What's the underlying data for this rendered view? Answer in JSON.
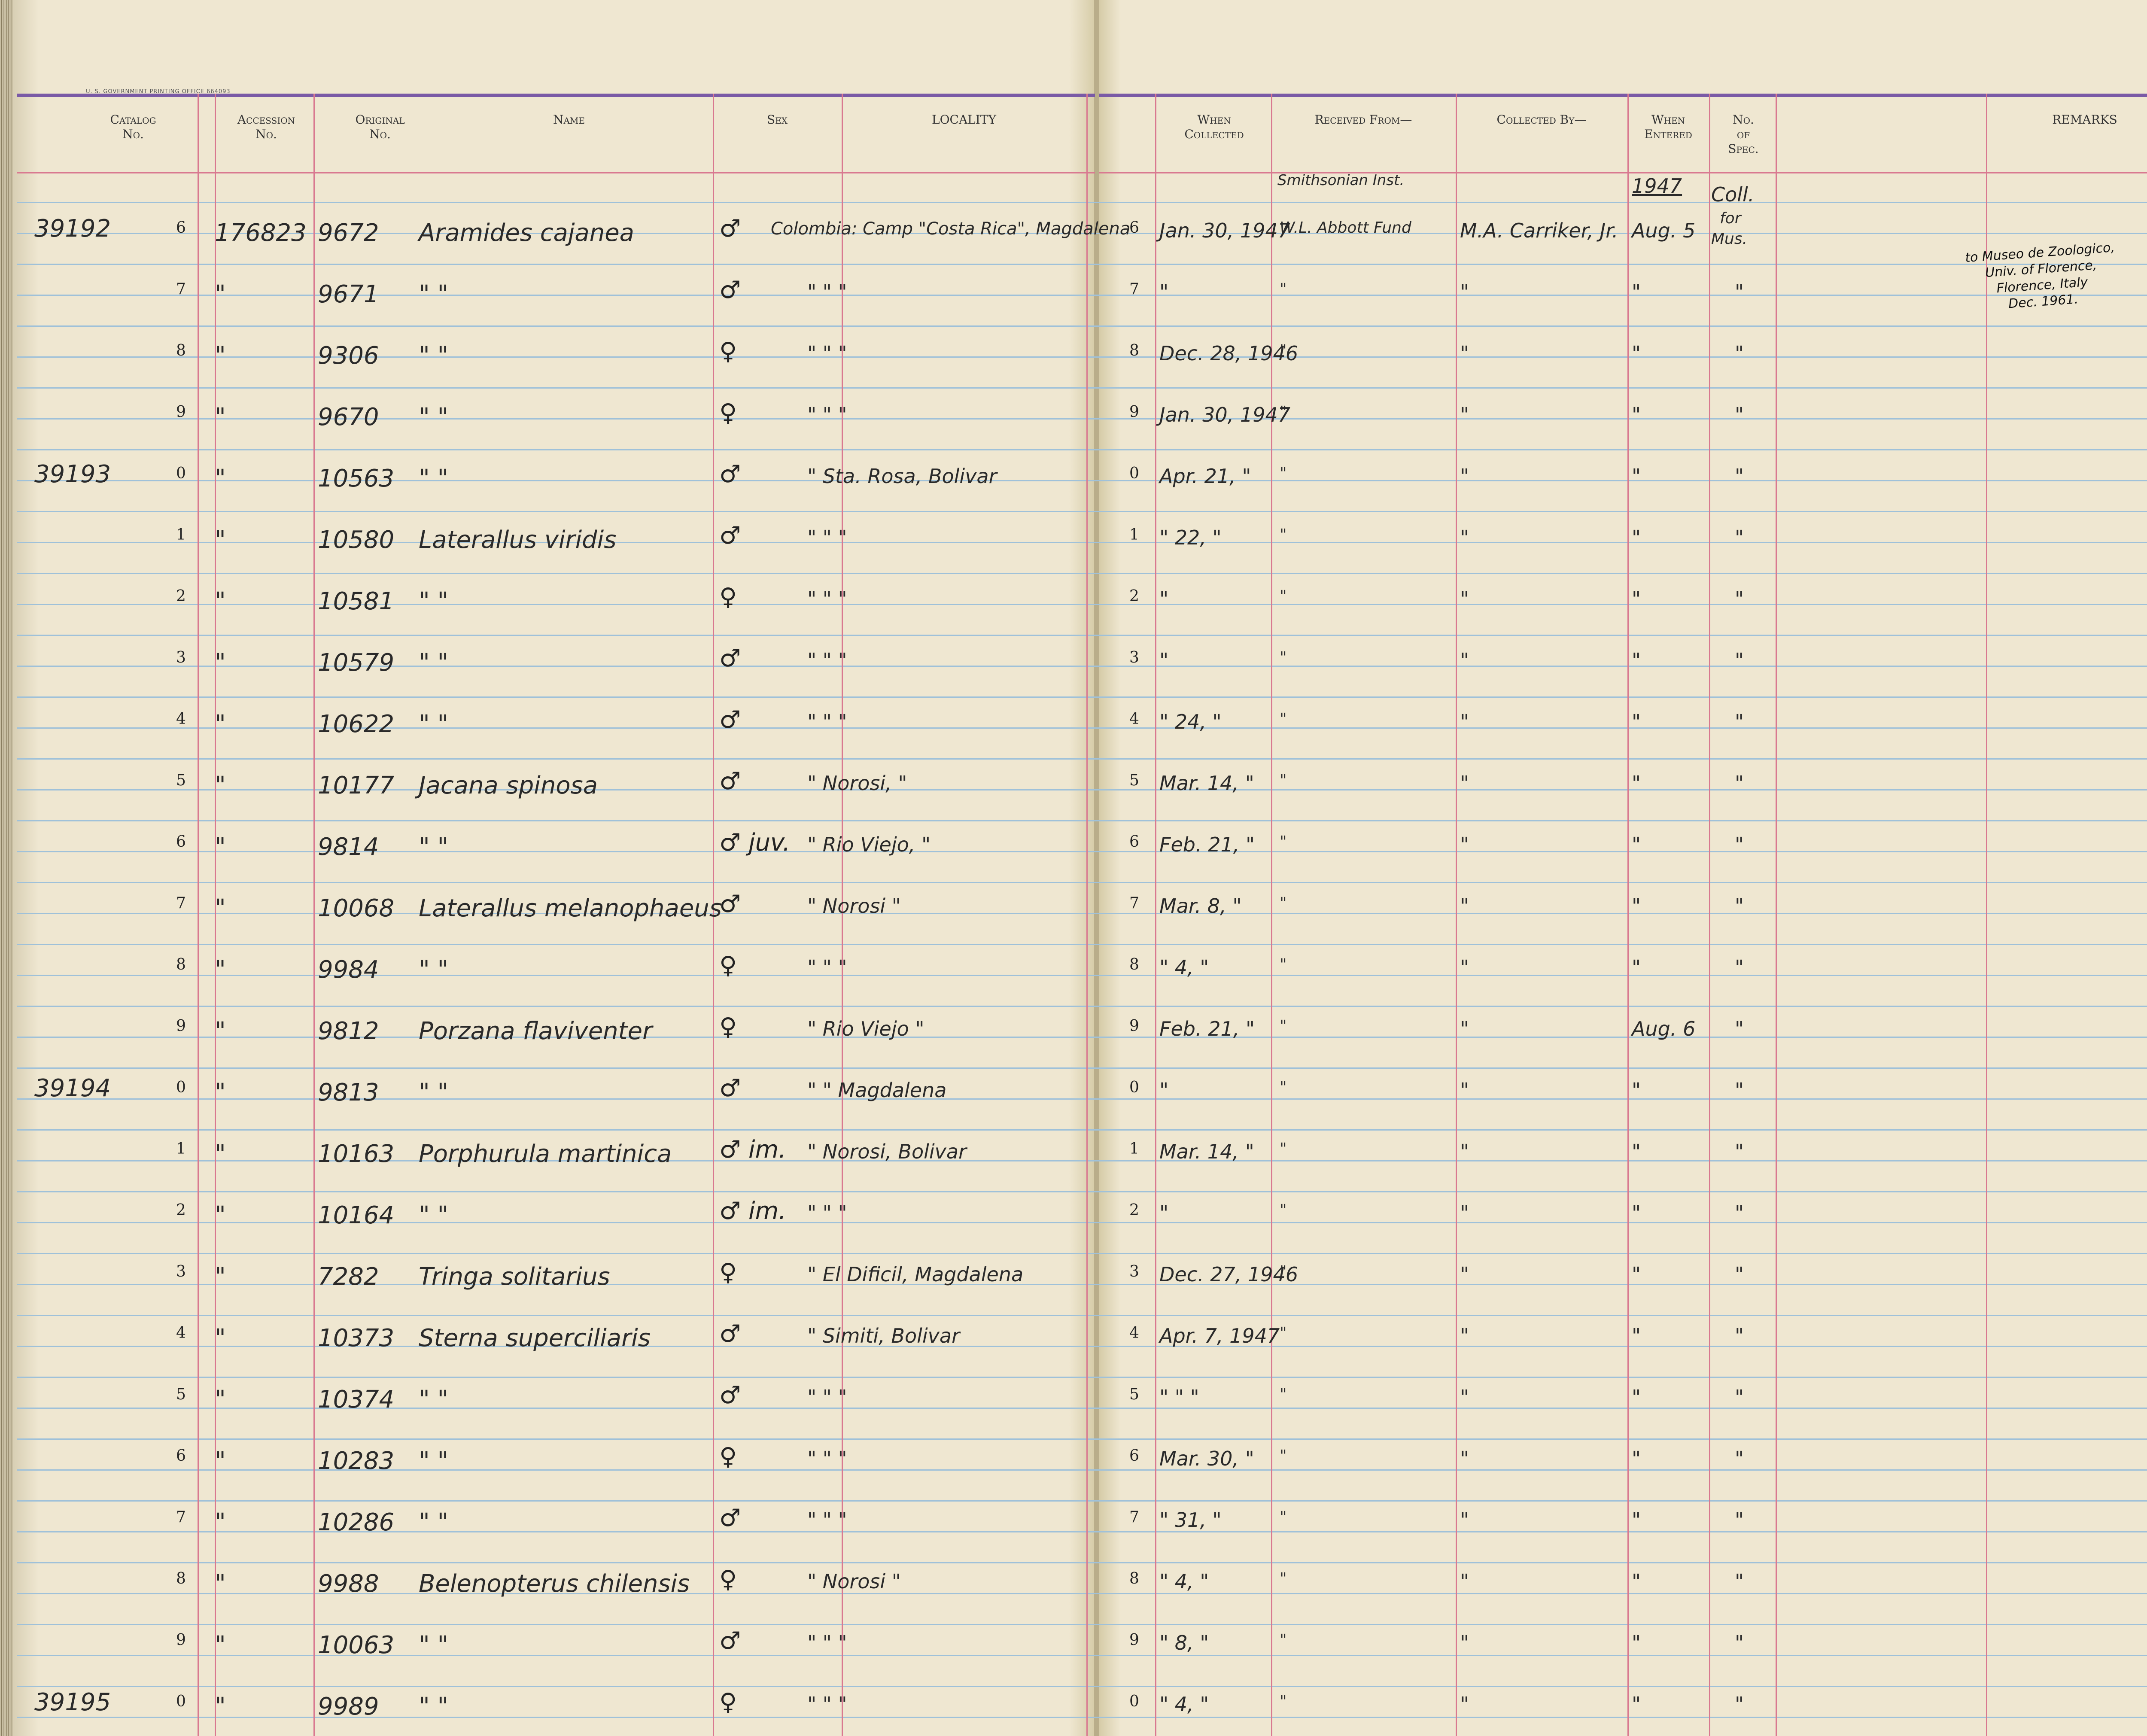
{
  "printer_note": "U. S. GOVERNMENT PRINTING OFFICE    664093",
  "headers": {
    "catalog": [
      "Catalog",
      "No."
    ],
    "accession": [
      "Accession",
      "No."
    ],
    "original": [
      "Original",
      "No."
    ],
    "name": [
      "Name"
    ],
    "sex": [
      "Sex"
    ],
    "locality": [
      "LOCALITY"
    ],
    "when_collected": [
      "When",
      "Collected"
    ],
    "received_from": [
      "Received From—"
    ],
    "collected_by": [
      "Collected By—"
    ],
    "when_entered": [
      "When",
      "Entered"
    ],
    "no_spec": [
      "No.",
      "of",
      "Spec."
    ],
    "remarks": [
      "REMARKS"
    ]
  },
  "first_row_extras": {
    "received_from_top": "Smithsonian Inst.",
    "year_entered_top": "1947",
    "no_spec_top": "Coll.",
    "no_spec_mid": "for",
    "no_spec_bottom": "Mus."
  },
  "remarks_note": [
    "to Museo de Zoologico,",
    "Univ. of Florence,",
    "Florence, Italy",
    "Dec. 1961."
  ],
  "rows": [
    {
      "catalog": "39192",
      "digit": "6",
      "accession": "176823",
      "original": "9672",
      "name": "Aramides cajanea",
      "sex": "♂",
      "locality": "Colombia: Camp \"Costa Rica\", Magdalena",
      "digit_r": "6",
      "date": "Jan. 30, 1947",
      "received": "W.L. Abbott Fund",
      "collector": "M.A. Carriker, Jr.",
      "entered": "Aug. 5",
      "spec": ""
    },
    {
      "catalog": "",
      "digit": "7",
      "accession": "\"",
      "original": "9671",
      "name": "\"      \"",
      "sex": "♂",
      "locality": "\"       \"       \"",
      "digit_r": "7",
      "date": "\"",
      "received": "\"",
      "collector": "\"",
      "entered": "\"",
      "spec": "\""
    },
    {
      "catalog": "",
      "digit": "8",
      "accession": "\"",
      "original": "9306",
      "name": "\"      \"",
      "sex": "♀",
      "locality": "\"       \"       \"",
      "digit_r": "8",
      "date": "Dec. 28, 1946",
      "received": "\"",
      "collector": "\"",
      "entered": "\"",
      "spec": "\""
    },
    {
      "catalog": "",
      "digit": "9",
      "accession": "\"",
      "original": "9670",
      "name": "\"      \"",
      "sex": "♀",
      "locality": "\"       \"       \"",
      "digit_r": "9",
      "date": "Jan. 30, 1947",
      "received": "\"",
      "collector": "\"",
      "entered": "\"",
      "spec": "\""
    },
    {
      "catalog": "39193",
      "digit": "0",
      "accession": "\"",
      "original": "10563",
      "name": "\"      \"",
      "sex": "♂",
      "locality": "\"      Sta. Rosa, Bolivar",
      "digit_r": "0",
      "date": "Apr. 21, \"",
      "received": "\"",
      "collector": "\"",
      "entered": "\"",
      "spec": "\""
    },
    {
      "catalog": "",
      "digit": "1",
      "accession": "\"",
      "original": "10580",
      "name": "Laterallus viridis",
      "sex": "♂",
      "locality": "\"       \"       \"",
      "digit_r": "1",
      "date": "\"  22, \"",
      "received": "\"",
      "collector": "\"",
      "entered": "\"",
      "spec": "\""
    },
    {
      "catalog": "",
      "digit": "2",
      "accession": "\"",
      "original": "10581",
      "name": "\"      \"",
      "sex": "♀",
      "locality": "\"       \"       \"",
      "digit_r": "2",
      "date": "\"",
      "received": "\"",
      "collector": "\"",
      "entered": "\"",
      "spec": "\""
    },
    {
      "catalog": "",
      "digit": "3",
      "accession": "\"",
      "original": "10579",
      "name": "\"      \"",
      "sex": "♂",
      "locality": "\"       \"       \"",
      "digit_r": "3",
      "date": "\"",
      "received": "\"",
      "collector": "\"",
      "entered": "\"",
      "spec": "\""
    },
    {
      "catalog": "",
      "digit": "4",
      "accession": "\"",
      "original": "10622",
      "name": "\"      \"",
      "sex": "♂",
      "locality": "\"       \"       \"",
      "digit_r": "4",
      "date": "\"  24, \"",
      "received": "\"",
      "collector": "\"",
      "entered": "\"",
      "spec": "\""
    },
    {
      "catalog": "",
      "digit": "5",
      "accession": "\"",
      "original": "10177",
      "name": "Jacana spinosa",
      "sex": "♂",
      "locality": "\"     Norosi,    \"",
      "digit_r": "5",
      "date": "Mar. 14, \"",
      "received": "\"",
      "collector": "\"",
      "entered": "\"",
      "spec": "\""
    },
    {
      "catalog": "",
      "digit": "6",
      "accession": "\"",
      "original": "9814",
      "name": "\"      \"",
      "sex": "♂ juv.",
      "locality": "\"   Rio Viejo,   \"",
      "digit_r": "6",
      "date": "Feb. 21, \"",
      "received": "\"",
      "collector": "\"",
      "entered": "\"",
      "spec": "\""
    },
    {
      "catalog": "",
      "digit": "7",
      "accession": "\"",
      "original": "10068",
      "name": "Laterallus melanophaeus",
      "sex": "♂",
      "locality": "\"     Norosi     \"",
      "digit_r": "7",
      "date": "Mar. 8, \"",
      "received": "\"",
      "collector": "\"",
      "entered": "\"",
      "spec": "\""
    },
    {
      "catalog": "",
      "digit": "8",
      "accession": "\"",
      "original": "9984",
      "name": "\"      \"",
      "sex": "♀",
      "locality": "\"       \"       \"",
      "digit_r": "8",
      "date": "\"  4, \"",
      "received": "\"",
      "collector": "\"",
      "entered": "\"",
      "spec": "\""
    },
    {
      "catalog": "",
      "digit": "9",
      "accession": "\"",
      "original": "9812",
      "name": "Porzana flaviventer",
      "sex": "♀",
      "locality": "\"   Rio Viejo   \"",
      "digit_r": "9",
      "date": "Feb. 21, \"",
      "received": "\"",
      "collector": "\"",
      "entered": "Aug. 6",
      "spec": "\""
    },
    {
      "catalog": "39194",
      "digit": "0",
      "accession": "\"",
      "original": "9813",
      "name": "\"      \"",
      "sex": "♂",
      "locality": "\"     \"    Magdalena",
      "digit_r": "0",
      "date": "\"",
      "received": "\"",
      "collector": "\"",
      "entered": "\"",
      "spec": "\""
    },
    {
      "catalog": "",
      "digit": "1",
      "accession": "\"",
      "original": "10163",
      "name": "Porphurula martinica",
      "sex": "♂ im.",
      "locality": "\"    Norosi, Bolivar",
      "digit_r": "1",
      "date": "Mar. 14, \"",
      "received": "\"",
      "collector": "\"",
      "entered": "\"",
      "spec": "\""
    },
    {
      "catalog": "",
      "digit": "2",
      "accession": "\"",
      "original": "10164",
      "name": "\"      \"",
      "sex": "♂ im.",
      "locality": "\"       \"       \"",
      "digit_r": "2",
      "date": "\"",
      "received": "\"",
      "collector": "\"",
      "entered": "\"",
      "spec": "\""
    },
    {
      "catalog": "",
      "digit": "3",
      "accession": "\"",
      "original": "7282",
      "name": "Tringa solitarius",
      "sex": "♀",
      "locality": "\"  El Dificil, Magdalena",
      "digit_r": "3",
      "date": "Dec. 27, 1946",
      "received": "\"",
      "collector": "\"",
      "entered": "\"",
      "spec": "\""
    },
    {
      "catalog": "",
      "digit": "4",
      "accession": "\"",
      "original": "10373",
      "name": "Sterna superciliaris",
      "sex": "♂",
      "locality": "\"   Simiti, Bolivar",
      "digit_r": "4",
      "date": "Apr. 7, 1947",
      "received": "\"",
      "collector": "\"",
      "entered": "\"",
      "spec": "\""
    },
    {
      "catalog": "",
      "digit": "5",
      "accession": "\"",
      "original": "10374",
      "name": "\"      \"",
      "sex": "♂",
      "locality": "\"       \"       \"",
      "digit_r": "5",
      "date": "\"  \"  \"",
      "received": "\"",
      "collector": "\"",
      "entered": "\"",
      "spec": "\""
    },
    {
      "catalog": "",
      "digit": "6",
      "accession": "\"",
      "original": "10283",
      "name": "\"      \"",
      "sex": "♀",
      "locality": "\"       \"       \"",
      "digit_r": "6",
      "date": "Mar. 30, \"",
      "received": "\"",
      "collector": "\"",
      "entered": "\"",
      "spec": "\""
    },
    {
      "catalog": "",
      "digit": "7",
      "accession": "\"",
      "original": "10286",
      "name": "\"      \"",
      "sex": "♂",
      "locality": "\"       \"       \"",
      "digit_r": "7",
      "date": "\"  31, \"",
      "received": "\"",
      "collector": "\"",
      "entered": "\"",
      "spec": "\""
    },
    {
      "catalog": "",
      "digit": "8",
      "accession": "\"",
      "original": "9988",
      "name": "Belenopterus chilensis",
      "sex": "♀",
      "locality": "\"     Norosi     \"",
      "digit_r": "8",
      "date": "\"  4, \"",
      "received": "\"",
      "collector": "\"",
      "entered": "\"",
      "spec": "\""
    },
    {
      "catalog": "",
      "digit": "9",
      "accession": "\"",
      "original": "10063",
      "name": "\"      \"",
      "sex": "♂",
      "locality": "\"       \"       \"",
      "digit_r": "9",
      "date": "\"  8, \"",
      "received": "\"",
      "collector": "\"",
      "entered": "\"",
      "spec": "\""
    },
    {
      "catalog": "39195",
      "digit": "0",
      "accession": "\"",
      "original": "9989",
      "name": "\"      \"",
      "sex": "♀",
      "locality": "\"       \"       \"",
      "digit_r": "0",
      "date": "\"  4, \"",
      "received": "\"",
      "collector": "\"",
      "entered": "\"",
      "spec": "\""
    }
  ]
}
